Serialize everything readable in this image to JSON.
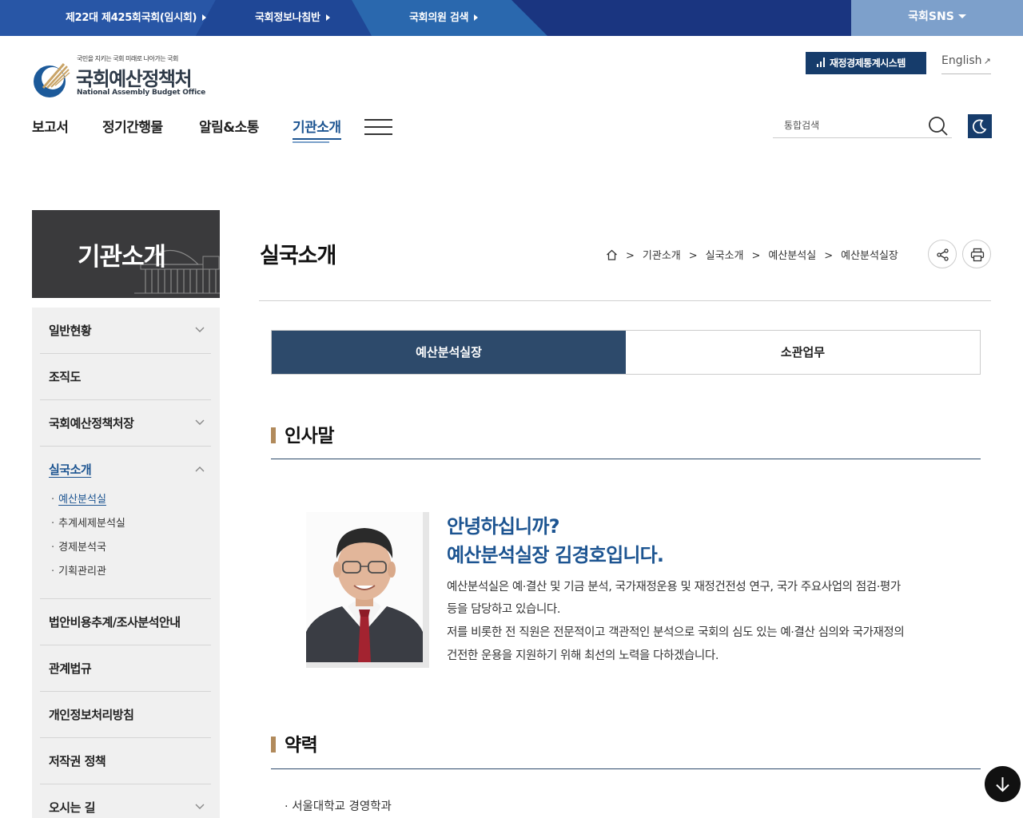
{
  "topbar": {
    "items": [
      "제22대 제425회국회(임시회)",
      "국회정보나침반",
      "국회의원 검색"
    ],
    "sns_label": "국회SNS"
  },
  "logo": {
    "slogan": "국민을 지키는 국회 미래로 나아가는 국회",
    "name": "국회예산정책처",
    "name_en": "National Assembly Budget Office"
  },
  "header": {
    "stat_button": "재정경제통계시스템",
    "english_label": "English",
    "search_placeholder": "통합검색"
  },
  "gnb": {
    "items": [
      "보고서",
      "정기간행물",
      "알림&소통",
      "기관소개"
    ],
    "active": "기관소개"
  },
  "sidebar": {
    "banner_title": "기관소개",
    "items": [
      {
        "label": "일반현황",
        "expandable": true
      },
      {
        "label": "조직도",
        "expandable": false
      },
      {
        "label": "국회예산정책처장",
        "expandable": true
      },
      {
        "label": "실국소개",
        "expandable": true,
        "open": true
      },
      {
        "label": "법안비용추계/조사분석안내",
        "expandable": false
      },
      {
        "label": "관계법규",
        "expandable": false
      },
      {
        "label": "개인정보처리방침",
        "expandable": false
      },
      {
        "label": "저작권 정책",
        "expandable": false
      },
      {
        "label": "오시는 길",
        "expandable": true
      }
    ],
    "sub_items": [
      "예산분석실",
      "추계세제분석실",
      "경제분석국",
      "기획관리관"
    ],
    "active_sub": "예산분석실"
  },
  "page": {
    "title": "실국소개",
    "breadcrumb": [
      "기관소개",
      "실국소개",
      "예산분석실",
      "예산분석실장"
    ]
  },
  "tabs": [
    {
      "label": "예산분석실장",
      "active": true
    },
    {
      "label": "소관업무",
      "active": false
    }
  ],
  "greeting": {
    "heading": "인사말",
    "line1": "안녕하십니까?",
    "line2": "예산분석실장 김경호입니다.",
    "paragraphs": [
      "예산분석실은 예·결산 및 기금 분석, 국가재정운용 및 재정건전성 연구, 국가 주요사업의 점검·평가",
      "등을 담당하고 있습니다.",
      "저를 비롯한 전 직원은 전문적이고 객관적인 분석으로 국회의 심도 있는 예·결산 심의와 국가재정의",
      "건전한 운용을 지원하기 위해 최선의 노력을 다하겠습니다."
    ]
  },
  "career": {
    "heading": "약력",
    "items": [
      "서울대학교 경영학과"
    ]
  },
  "colors": {
    "topbar": "#1a3580",
    "sns": "#7da0cb",
    "accent": "#1c5491",
    "tab_active": "#2d4a6b",
    "section_bar": "#b18a5b"
  }
}
